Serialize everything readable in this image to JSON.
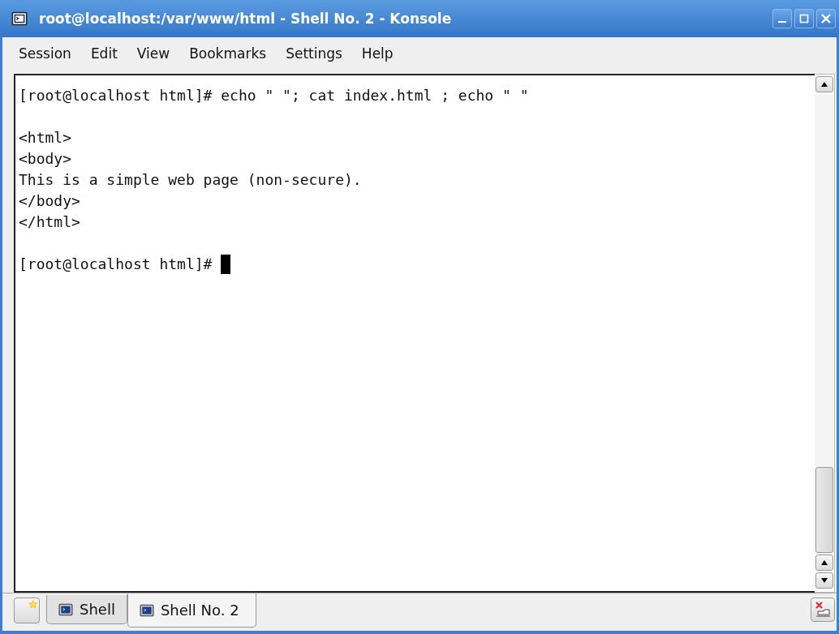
{
  "window": {
    "title": "root@localhost:/var/www/html - Shell No. 2 - Konsole"
  },
  "menu": [
    "Session",
    "Edit",
    "View",
    "Bookmarks",
    "Settings",
    "Help"
  ],
  "terminal": {
    "blocks": [
      {
        "lines": [
          "[root@localhost html]# echo \" \"; cat index.html ; echo \" \""
        ]
      },
      {
        "lines": [
          "<html>",
          "<body>",
          "This is a simple web page (non-secure).",
          "</body>",
          "</html>"
        ]
      },
      {
        "lines": [
          "[root@localhost html]# "
        ]
      }
    ],
    "cursor": true
  },
  "tabs": [
    {
      "label": "Shell",
      "selected": false
    },
    {
      "label": "Shell No. 2",
      "selected": true
    }
  ]
}
